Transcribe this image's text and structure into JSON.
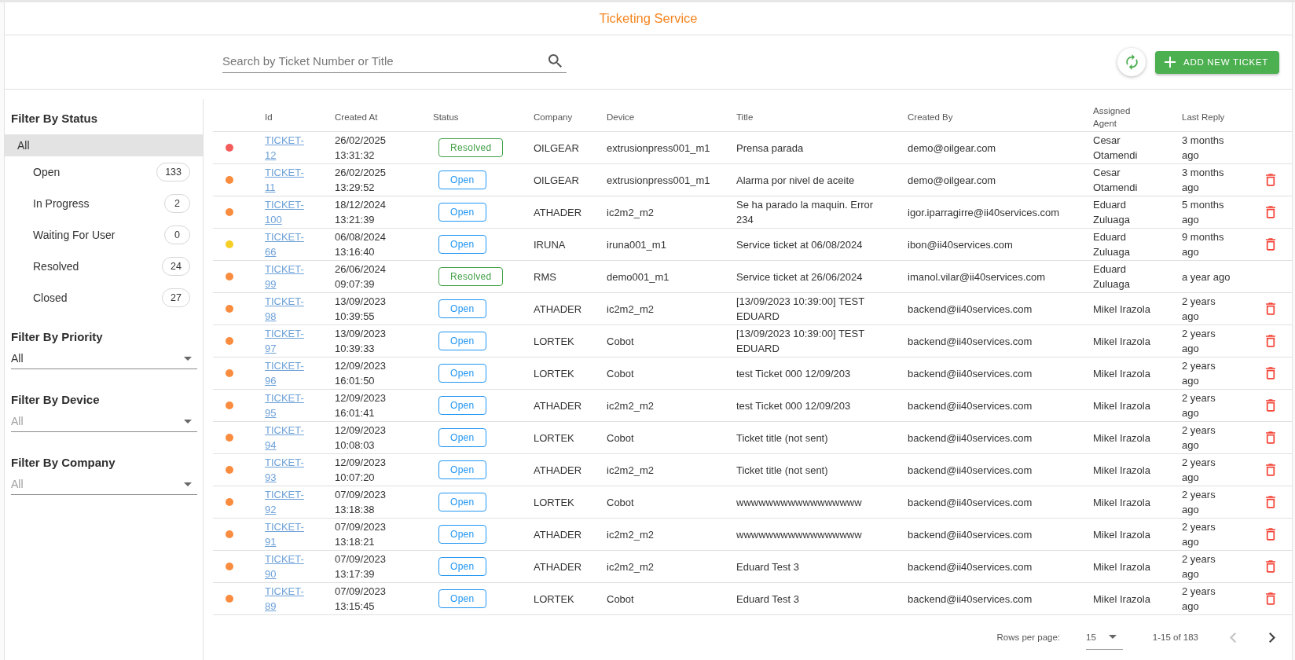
{
  "header": {
    "title": "Ticketing Service"
  },
  "toolbar": {
    "search": {
      "placeholder": "Search by Ticket Number or Title"
    },
    "add_button": {
      "label": "ADD NEW TICKET"
    }
  },
  "sidebar": {
    "status_filter": {
      "title": "Filter By Status",
      "items": [
        {
          "label": "All",
          "selected": true,
          "children": [
            {
              "label": "Open",
              "count": "133",
              "selected": false
            },
            {
              "label": "In Progress",
              "count": "2",
              "selected": false
            },
            {
              "label": "Waiting For User",
              "count": "0",
              "selected": false
            },
            {
              "label": "Resolved",
              "count": "24",
              "selected": false
            },
            {
              "label": "Closed",
              "count": "27",
              "selected": false
            }
          ]
        }
      ]
    },
    "selects": [
      {
        "title": "Filter By Priority",
        "value": "All"
      },
      {
        "title": "Filter By Device",
        "placeholder": "All"
      },
      {
        "title": "Filter By Company",
        "placeholder": "All"
      }
    ]
  },
  "table": {
    "columns": [
      "Id",
      "Created At",
      "Status",
      "Company",
      "Device",
      "Title",
      "Created By",
      "Assigned Agent",
      "Last Reply"
    ],
    "rows": [
      {
        "color": "#f45b5b",
        "id": "TICKET-12",
        "created_at": "26/02/2025 13:31:32",
        "status": {
          "label": "Resolved",
          "kind": "resolved"
        },
        "company": "OILGEAR",
        "device": "extrusionpress001_m1",
        "title": "Prensa parada",
        "created_by": "demo@oilgear.com",
        "assigned_agent": "Cesar Otamendi",
        "last_reply": "3 months ago",
        "deletable": false
      },
      {
        "color": "#f98c3f",
        "id": "TICKET-11",
        "created_at": "26/02/2025 13:29:52",
        "status": {
          "label": "Open",
          "kind": "open"
        },
        "company": "OILGEAR",
        "device": "extrusionpress001_m1",
        "title": "Alarma por nivel de aceite",
        "created_by": "demo@oilgear.com",
        "assigned_agent": "Cesar Otamendi",
        "last_reply": "3 months ago",
        "deletable": true
      },
      {
        "color": "#f98c3f",
        "id": "TICKET-100",
        "created_at": "18/12/2024 13:21:39",
        "status": {
          "label": "Open",
          "kind": "open"
        },
        "company": "ATHADER",
        "device": "ic2m2_m2",
        "title": "Se ha parado la maquin. Error 234",
        "created_by": "igor.iparragirre@ii40services.com",
        "assigned_agent": "Eduard Zuluaga",
        "last_reply": "5 months ago",
        "deletable": true
      },
      {
        "color": "#f5cf26",
        "id": "TICKET-66",
        "created_at": "06/08/2024 13:16:40",
        "status": {
          "label": "Open",
          "kind": "open"
        },
        "company": "IRUNA",
        "device": "iruna001_m1",
        "title": "Service ticket at 06/08/2024",
        "created_by": "ibon@ii40services.com",
        "assigned_agent": "Eduard Zuluaga",
        "last_reply": "9 months ago",
        "deletable": true
      },
      {
        "color": "#f98c3f",
        "id": "TICKET-99",
        "created_at": "26/06/2024 09:07:39",
        "status": {
          "label": "Resolved",
          "kind": "resolved"
        },
        "company": "RMS",
        "device": "demo001_m1",
        "title": "Service ticket at 26/06/2024",
        "created_by": "imanol.vilar@ii40services.com",
        "assigned_agent": "Eduard Zuluaga",
        "last_reply": "a year ago",
        "deletable": false
      },
      {
        "color": "#f98c3f",
        "id": "TICKET-98",
        "created_at": "13/09/2023 10:39:55",
        "status": {
          "label": "Open",
          "kind": "open"
        },
        "company": "ATHADER",
        "device": "ic2m2_m2",
        "title": "[13/09/2023 10:39:00] TEST EDUARD",
        "created_by": "backend@ii40services.com",
        "assigned_agent": "Mikel Irazola",
        "last_reply": "2 years ago",
        "deletable": true
      },
      {
        "color": "#f98c3f",
        "id": "TICKET-97",
        "created_at": "13/09/2023 10:39:33",
        "status": {
          "label": "Open",
          "kind": "open"
        },
        "company": "LORTEK",
        "device": "Cobot",
        "title": "[13/09/2023 10:39:00] TEST EDUARD",
        "created_by": "backend@ii40services.com",
        "assigned_agent": "Mikel Irazola",
        "last_reply": "2 years ago",
        "deletable": true
      },
      {
        "color": "#f98c3f",
        "id": "TICKET-96",
        "created_at": "12/09/2023 16:01:50",
        "status": {
          "label": "Open",
          "kind": "open"
        },
        "company": "LORTEK",
        "device": "Cobot",
        "title": "test Ticket 000 12/09/203",
        "created_by": "backend@ii40services.com",
        "assigned_agent": "Mikel Irazola",
        "last_reply": "2 years ago",
        "deletable": true
      },
      {
        "color": "#f98c3f",
        "id": "TICKET-95",
        "created_at": "12/09/2023 16:01:41",
        "status": {
          "label": "Open",
          "kind": "open"
        },
        "company": "ATHADER",
        "device": "ic2m2_m2",
        "title": "test Ticket 000 12/09/203",
        "created_by": "backend@ii40services.com",
        "assigned_agent": "Mikel Irazola",
        "last_reply": "2 years ago",
        "deletable": true
      },
      {
        "color": "#f98c3f",
        "id": "TICKET-94",
        "created_at": "12/09/2023 10:08:03",
        "status": {
          "label": "Open",
          "kind": "open"
        },
        "company": "LORTEK",
        "device": "Cobot",
        "title": "Ticket title (not sent)",
        "created_by": "backend@ii40services.com",
        "assigned_agent": "Mikel Irazola",
        "last_reply": "2 years ago",
        "deletable": true
      },
      {
        "color": "#f98c3f",
        "id": "TICKET-93",
        "created_at": "12/09/2023 10:07:20",
        "status": {
          "label": "Open",
          "kind": "open"
        },
        "company": "ATHADER",
        "device": "ic2m2_m2",
        "title": "Ticket title (not sent)",
        "created_by": "backend@ii40services.com",
        "assigned_agent": "Mikel Irazola",
        "last_reply": "2 years ago",
        "deletable": true
      },
      {
        "color": "#f98c3f",
        "id": "TICKET-92",
        "created_at": "07/09/2023 13:18:38",
        "status": {
          "label": "Open",
          "kind": "open"
        },
        "company": "LORTEK",
        "device": "Cobot",
        "title": "wwwwwwwwwwwwwwwww",
        "created_by": "backend@ii40services.com",
        "assigned_agent": "Mikel Irazola",
        "last_reply": "2 years ago",
        "deletable": true
      },
      {
        "color": "#f98c3f",
        "id": "TICKET-91",
        "created_at": "07/09/2023 13:18:21",
        "status": {
          "label": "Open",
          "kind": "open"
        },
        "company": "ATHADER",
        "device": "ic2m2_m2",
        "title": "wwwwwwwwwwwwwwwww",
        "created_by": "backend@ii40services.com",
        "assigned_agent": "Mikel Irazola",
        "last_reply": "2 years ago",
        "deletable": true
      },
      {
        "color": "#f98c3f",
        "id": "TICKET-90",
        "created_at": "07/09/2023 13:17:39",
        "status": {
          "label": "Open",
          "kind": "open"
        },
        "company": "ATHADER",
        "device": "ic2m2_m2",
        "title": "Eduard Test 3",
        "created_by": "backend@ii40services.com",
        "assigned_agent": "Mikel Irazola",
        "last_reply": "2 years ago",
        "deletable": true
      },
      {
        "color": "#f98c3f",
        "id": "TICKET-89",
        "created_at": "07/09/2023 13:15:45",
        "status": {
          "label": "Open",
          "kind": "open"
        },
        "company": "LORTEK",
        "device": "Cobot",
        "title": "Eduard Test 3",
        "created_by": "backend@ii40services.com",
        "assigned_agent": "Mikel Irazola",
        "last_reply": "2 years ago",
        "deletable": true
      }
    ]
  },
  "pagination": {
    "rows_per_page_label": "Rows per page:",
    "rows_per_page": "15",
    "range": "1-15 of 183",
    "prev": {
      "disabled": true
    },
    "next": {
      "disabled": false
    }
  }
}
